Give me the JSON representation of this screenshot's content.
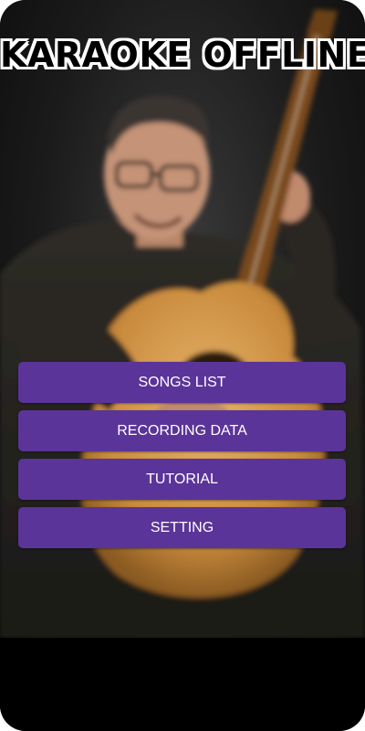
{
  "app": {
    "title": "KARAOKE OFFLINE"
  },
  "menu": {
    "items": [
      {
        "label": "SONGS LIST"
      },
      {
        "label": "RECORDING DATA"
      },
      {
        "label": "TUTORIAL"
      },
      {
        "label": "SETTING"
      }
    ]
  },
  "colors": {
    "button_bg": "#5b3499",
    "button_text": "#ffffff",
    "title_text": "#000000",
    "title_outline": "#ffffff",
    "background": "#000000"
  },
  "images": {
    "hero": "man-with-acoustic-guitar-photo"
  }
}
